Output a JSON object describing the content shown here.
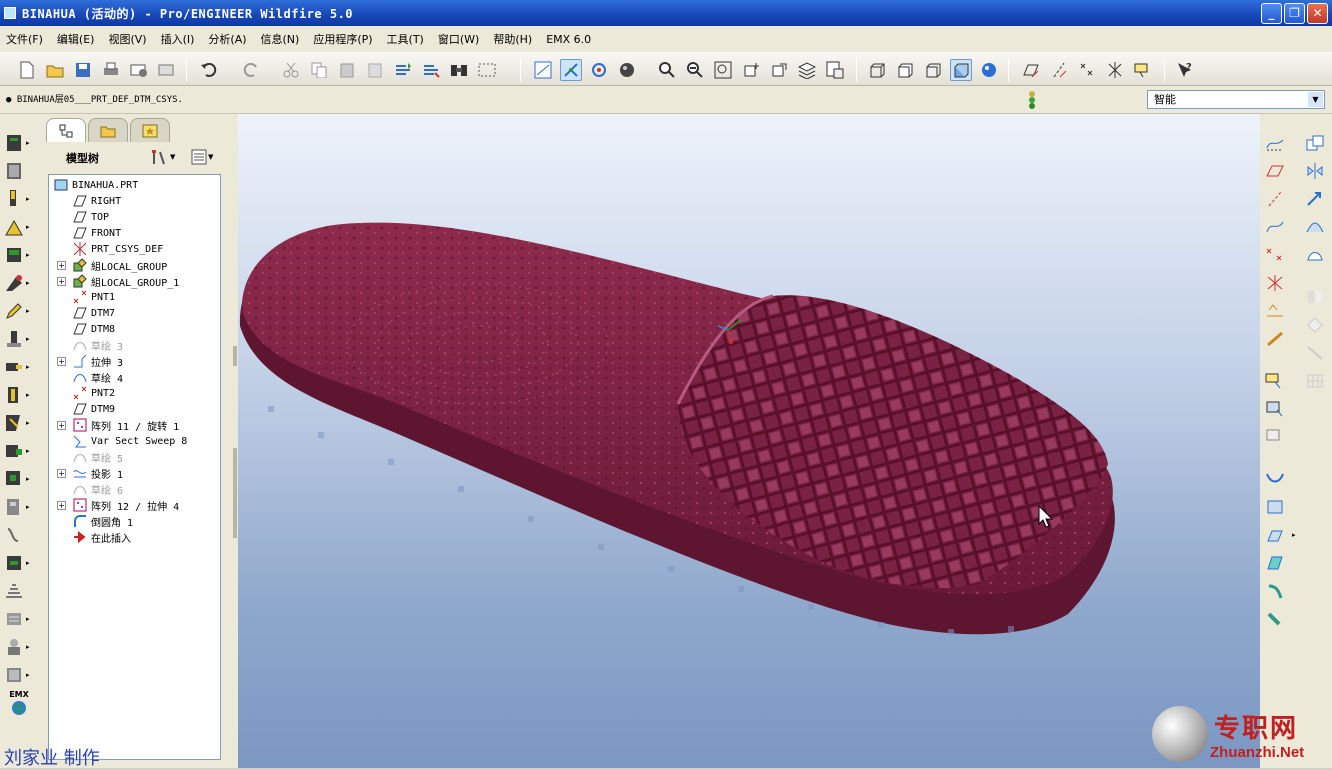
{
  "window": {
    "title": "BINAHUA (活动的) - Pro/ENGINEER Wildfire 5.0",
    "controls": [
      "_",
      "❐",
      "✕"
    ]
  },
  "menubar": {
    "items": [
      "文件(F)",
      "编辑(E)",
      "视图(V)",
      "插入(I)",
      "分析(A)",
      "信息(N)",
      "应用程序(P)",
      "工具(T)",
      "窗口(W)",
      "帮助(H)",
      "EMX 6.0"
    ]
  },
  "status": {
    "message": "● BINAHUA层05___PRT_DEF_DTM_CSYS.",
    "selection_filter": "智能",
    "filter_arrow": "▼"
  },
  "model_tree": {
    "title": "模型树",
    "nodes": [
      {
        "label": "BINAHUA.PRT",
        "icon": "part-icon",
        "expandable": false,
        "suppressed": false
      },
      {
        "label": "RIGHT",
        "icon": "datum-plane-icon",
        "expandable": false,
        "suppressed": false
      },
      {
        "label": "TOP",
        "icon": "datum-plane-icon",
        "expandable": false,
        "suppressed": false
      },
      {
        "label": "FRONT",
        "icon": "datum-plane-icon",
        "expandable": false,
        "suppressed": false
      },
      {
        "label": "PRT_CSYS_DEF",
        "icon": "csys-icon",
        "expandable": false,
        "suppressed": false
      },
      {
        "label": "組LOCAL_GROUP",
        "icon": "group-icon",
        "expandable": true,
        "suppressed": false
      },
      {
        "label": "組LOCAL_GROUP_1",
        "icon": "group-icon",
        "expandable": true,
        "suppressed": false
      },
      {
        "label": "PNT1",
        "icon": "datum-point-icon",
        "expandable": false,
        "suppressed": false
      },
      {
        "label": "DTM7",
        "icon": "datum-plane-icon",
        "expandable": false,
        "suppressed": false
      },
      {
        "label": "DTM8",
        "icon": "datum-plane-icon",
        "expandable": false,
        "suppressed": false
      },
      {
        "label": "草绘 3",
        "icon": "sketch-icon",
        "expandable": false,
        "suppressed": true
      },
      {
        "label": "拉伸 3",
        "icon": "extrude-icon",
        "expandable": true,
        "suppressed": false
      },
      {
        "label": "草绘 4",
        "icon": "sketch-icon",
        "expandable": false,
        "suppressed": false
      },
      {
        "label": "PNT2",
        "icon": "datum-point-icon",
        "expandable": false,
        "suppressed": false
      },
      {
        "label": "DTM9",
        "icon": "datum-plane-icon",
        "expandable": false,
        "suppressed": false
      },
      {
        "label": "阵列 11 / 旋转 1",
        "icon": "pattern-icon",
        "expandable": true,
        "suppressed": false
      },
      {
        "label": "Var Sect Sweep 8",
        "icon": "sweep-icon",
        "expandable": false,
        "suppressed": false
      },
      {
        "label": "草绘 5",
        "icon": "sketch-icon",
        "expandable": false,
        "suppressed": true
      },
      {
        "label": "投影 1",
        "icon": "projection-icon",
        "expandable": true,
        "suppressed": false
      },
      {
        "label": "草绘 6",
        "icon": "sketch-icon",
        "expandable": false,
        "suppressed": true
      },
      {
        "label": "阵列 12 / 拉伸 4",
        "icon": "pattern-icon",
        "expandable": true,
        "suppressed": false
      },
      {
        "label": "倒圆角 1",
        "icon": "round-icon",
        "expandable": false,
        "suppressed": false
      },
      {
        "label": "在此插入",
        "icon": "insert-here-arrow-icon",
        "expandable": false,
        "suppressed": false
      }
    ]
  },
  "left_toolbar": {
    "emx_label": "EMX"
  },
  "overlay": {
    "credit": "刘家业 制作",
    "watermark_title": "专职网",
    "watermark_url": "Zhuanzhi.Net"
  },
  "colors": {
    "model": "#8a2a4a",
    "model_dark": "#5e1530",
    "titlebar": "#1746b8"
  }
}
